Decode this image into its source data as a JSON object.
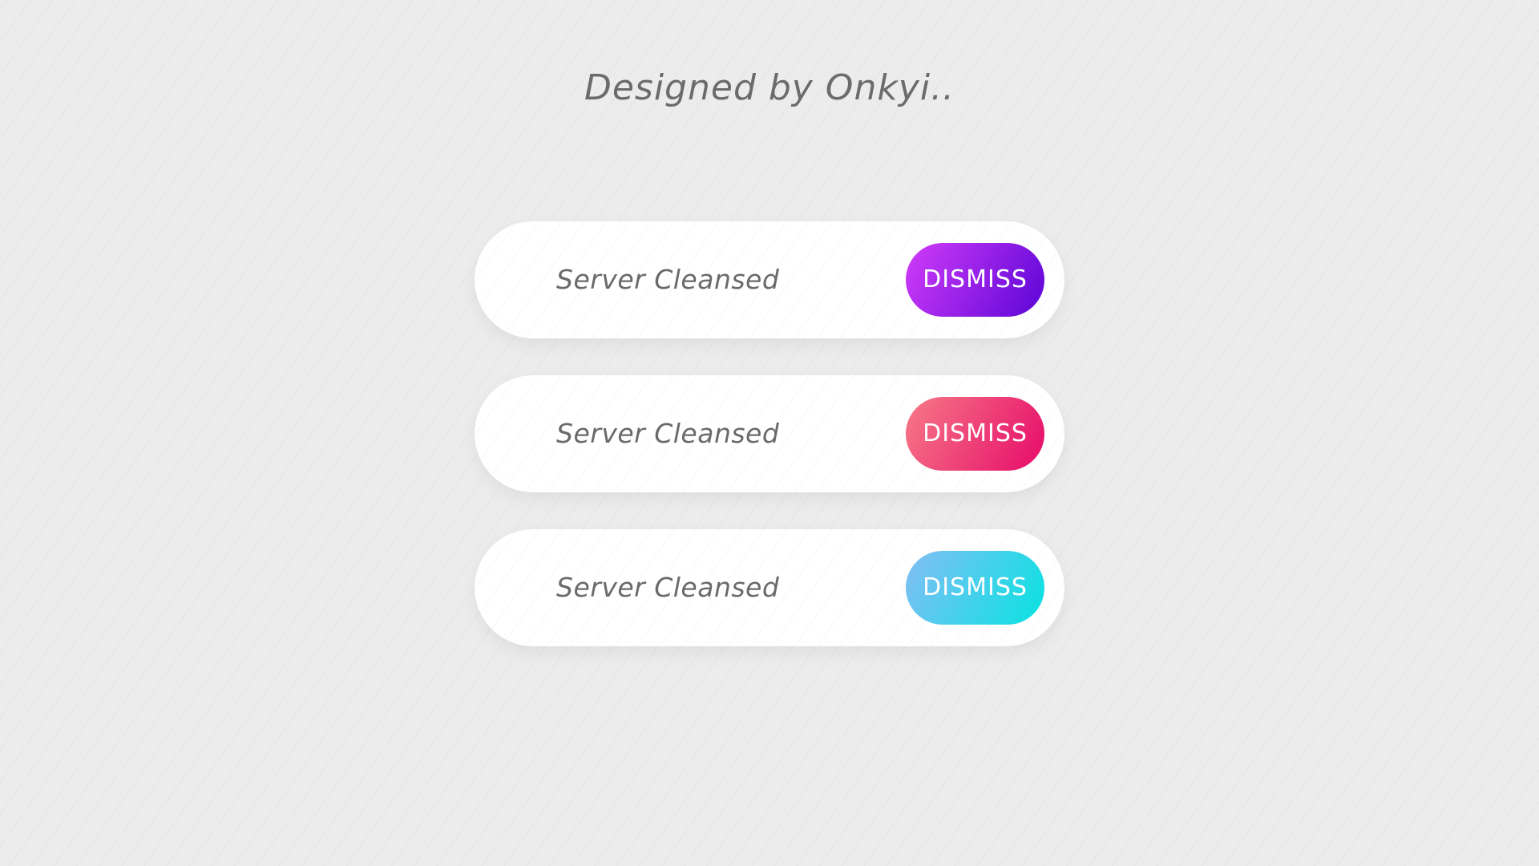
{
  "header": {
    "title": "Designed by Onkyi.."
  },
  "notifications": [
    {
      "message": "Server Cleansed",
      "button_label": "DISMISS",
      "gradient_start": "#d13cf9",
      "gradient_end": "#5b05d6"
    },
    {
      "message": "Server Cleansed",
      "button_label": "DISMISS",
      "gradient_start": "#f77a86",
      "gradient_end": "#e60a6a"
    },
    {
      "message": "Server Cleansed",
      "button_label": "DISMISS",
      "gradient_start": "#84bdf5",
      "gradient_end": "#07e3e1"
    }
  ],
  "colors": {
    "background": "#ececec",
    "card": "#ffffff",
    "text": "#6a6a6a"
  }
}
